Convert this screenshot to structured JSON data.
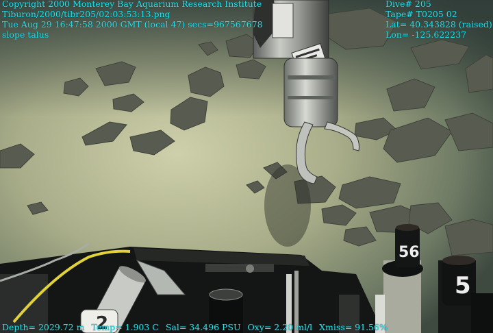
{
  "overlay": {
    "copyright": "Copyright 2000 Monterey Bay Aquarium Research Institute",
    "filename": "Tiburon/2000/tibr205/02:03:53:13.png",
    "timestamp": "Tue Aug 29 16:47:58 2000 GMT (local 47) secs=967567678",
    "caption": "slope talus",
    "dive": "Dive# 205",
    "tape": "Tape# T0205 02",
    "lat": "Lat= 40.343828 (raised)",
    "lon": "Lon= -125.622237",
    "depth": "Depth= 2029.72 m",
    "temp": "Temp= 1.903 C",
    "sal": "Sal= 34.496 PSU",
    "oxy": "Oxy= 2.20 ml/l",
    "xmiss": "Xmiss= 91.56%"
  },
  "scene": {
    "tube_labels": [
      "2",
      "56",
      "5"
    ],
    "colors": {
      "overlay_text": "#1fe4ee",
      "sediment": "#b6b894",
      "rock": "#575a4f",
      "hose": "#e1d23a"
    }
  }
}
